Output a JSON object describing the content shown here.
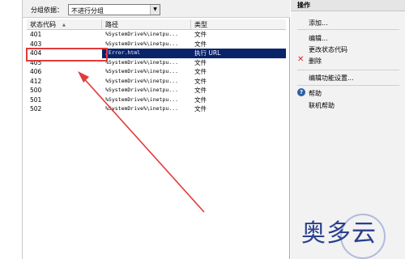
{
  "toolbar": {
    "group_by_label": "分组依据：",
    "group_by_value": "不进行分组"
  },
  "table": {
    "headers": [
      "状态代码",
      "路径",
      "类型"
    ],
    "rows": [
      {
        "code": "401",
        "path": "%SystemDrive%\\inetpu...",
        "type": "文件"
      },
      {
        "code": "403",
        "path": "%SystemDrive%\\inetpu...",
        "type": "文件"
      },
      {
        "code": "404",
        "path": "/Error.html",
        "type": "执行 URL"
      },
      {
        "code": "405",
        "path": "%SystemDrive%\\inetpu...",
        "type": "文件"
      },
      {
        "code": "406",
        "path": "%SystemDrive%\\inetpu...",
        "type": "文件"
      },
      {
        "code": "412",
        "path": "%SystemDrive%\\inetpu...",
        "type": "文件"
      },
      {
        "code": "500",
        "path": "%SystemDrive%\\inetpu...",
        "type": "文件"
      },
      {
        "code": "501",
        "path": "%SystemDrive%\\inetpu...",
        "type": "文件"
      },
      {
        "code": "502",
        "path": "%SystemDrive%\\inetpu...",
        "type": "文件"
      }
    ],
    "selected_row": "404"
  },
  "actions": {
    "title": "操作",
    "add": "添加...",
    "edit": "编辑...",
    "change_status_code": "更改状态代码",
    "delete": "删除",
    "edit_feature_settings": "编辑功能设置...",
    "help": "帮助",
    "online_help": "联机帮助"
  },
  "icons": {
    "delete": "x-icon",
    "help": "question-circle-icon"
  },
  "colors": {
    "selection": "#0a246a",
    "annotation": "#e23b3b",
    "delete_icon": "#e02020",
    "watermark": "#2a3f8f"
  },
  "watermark": {
    "text": "奥多云"
  }
}
